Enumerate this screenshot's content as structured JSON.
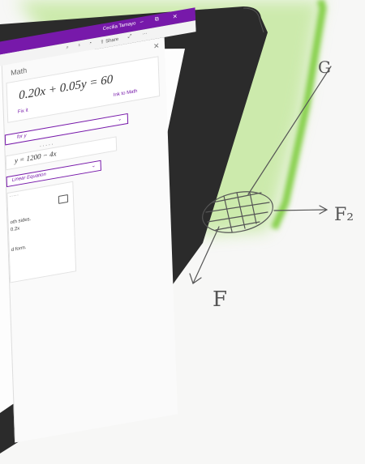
{
  "window": {
    "user_name": "Cecilia Tamayo",
    "min_glyph": "–",
    "restore_glyph": "⧉",
    "close_glyph": "✕"
  },
  "toolbar": {
    "share_label": "Share",
    "more_glyph": "···"
  },
  "math_pane": {
    "title": "Math",
    "close_glyph": "✕",
    "equation": "0.20x + 0.05y = 60",
    "fix_it": "Fix it",
    "ink_to_math": "Ink to Math",
    "solve_option": "for y",
    "dots": "·····",
    "solution": "y = 1200 − 4x",
    "graph_option": "Linear Equation",
    "steps": [
      "oth sides.",
      "0.2x",
      "",
      "d form."
    ]
  },
  "sketch": {
    "labels": {
      "top": "G",
      "right": "F₂",
      "bottom": "F"
    }
  },
  "colors": {
    "accent": "#7719aa",
    "bezel": "#2b2b2b",
    "glow": "#8fd44a",
    "ink": "#555555"
  }
}
